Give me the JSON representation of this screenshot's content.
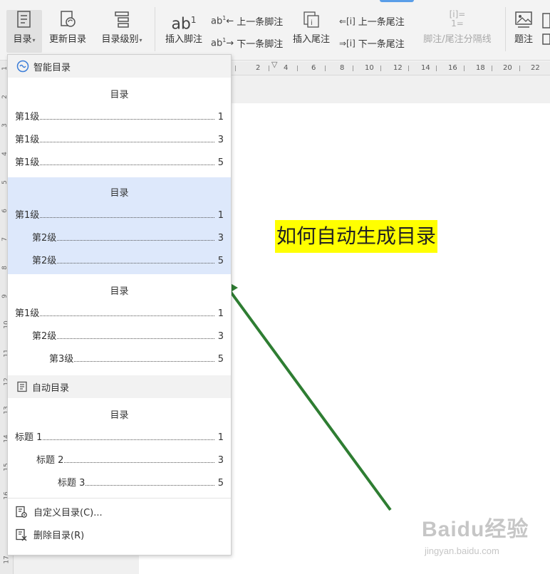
{
  "ribbon": {
    "toc_button": "目录",
    "update_toc": "更新目录",
    "toc_level": "目录级别",
    "insert_footnote": "插入脚注",
    "footnote_glyph": "ab",
    "footnote_sup": "1",
    "prev_footnote": "上一条脚注",
    "next_footnote": "下一条脚注",
    "insert_endnote": "插入尾注",
    "prev_endnote": "上一条尾注",
    "next_endnote": "下一条尾注",
    "separator_line": "脚注/尾注分隔线",
    "caption": "题注"
  },
  "panel": {
    "smart_toc_header": "智能目录",
    "auto_toc_header": "自动目录",
    "custom_toc": "自定义目录(C)...",
    "delete_toc": "删除目录(R)",
    "blocks": [
      {
        "title": "目录",
        "rows": [
          {
            "text": "第1级",
            "page": "1"
          },
          {
            "text": "第1级",
            "page": "3"
          },
          {
            "text": "第1级",
            "page": "5"
          }
        ]
      },
      {
        "title": "目录",
        "rows": [
          {
            "text": "第1级",
            "page": "1"
          },
          {
            "text": "第2级",
            "page": "3"
          },
          {
            "text": "第2级",
            "page": "5"
          }
        ]
      },
      {
        "title": "目录",
        "rows": [
          {
            "text": "第1级",
            "page": "1"
          },
          {
            "text": "第2级",
            "page": "3"
          },
          {
            "text": "第3级",
            "page": "5"
          }
        ]
      },
      {
        "title": "目录",
        "rows": [
          {
            "text": "标题 1",
            "page": "1"
          },
          {
            "text": "标题 2",
            "page": "3"
          },
          {
            "text": "标题 3",
            "page": "5"
          }
        ]
      }
    ]
  },
  "ruler": {
    "h_numbers": [
      "2",
      "4",
      "6",
      "8",
      "10",
      "12",
      "14",
      "16",
      "18",
      "20",
      "22"
    ],
    "v_numbers": [
      "1",
      "2",
      "3",
      "4",
      "5",
      "6",
      "7",
      "8",
      "9",
      "10",
      "11",
      "12",
      "13",
      "14",
      "15",
      "16",
      "17"
    ]
  },
  "document": {
    "title": "如何自动生成目录"
  },
  "watermark": {
    "text": "Baidu经验",
    "sub": "jingyan.baidu.com"
  },
  "colors": {
    "highlight": "#ffff00",
    "selected_block": "#dde8fb",
    "arrow": "#2e7d32"
  }
}
